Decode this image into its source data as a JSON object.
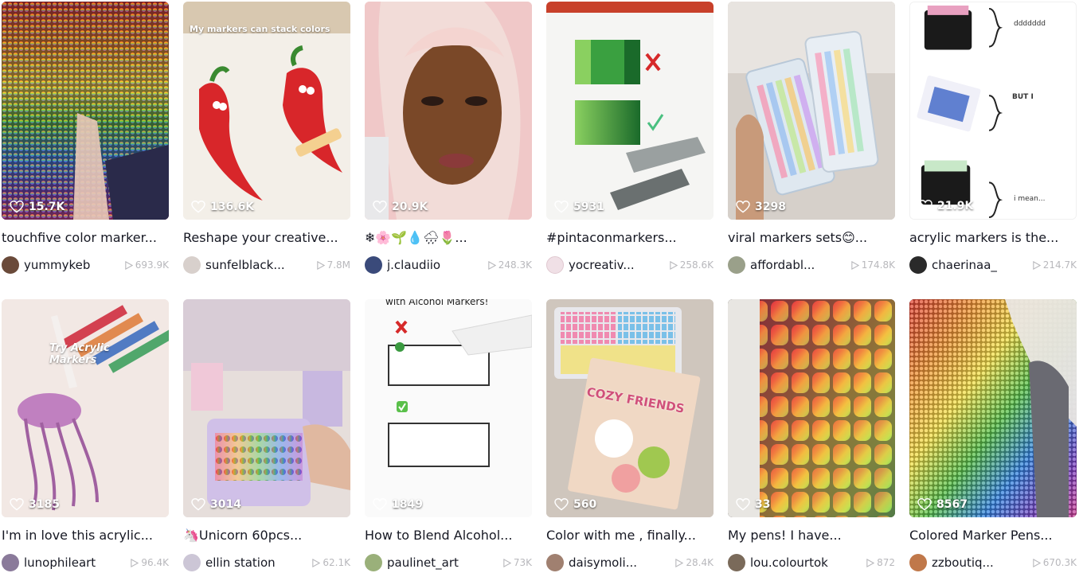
{
  "videos": [
    {
      "title": "touchfive color marker...",
      "author": "yummykeb",
      "views": "693.9K",
      "likes": "15.7K",
      "avatar_color": "#6a4a3a"
    },
    {
      "title": "Reshape your creative...",
      "author": "sunfelblack...",
      "views": "7.8M",
      "likes": "136.6K",
      "avatar_color": "#d8d0cc",
      "overlay": "My markers can stack colors"
    },
    {
      "title": "❄🌸🌱💧🌧🌷...",
      "author": "j.claudiio",
      "views": "248.3K",
      "likes": "20.9K",
      "avatar_color": "#3a4a7a"
    },
    {
      "title": "#pintaconmarkers...",
      "author": "yocreativ...",
      "views": "258.6K",
      "likes": "5931",
      "avatar_color": "#f0e0e6"
    },
    {
      "title": "viral markers sets😊...",
      "author": "affordabl...",
      "views": "174.8K",
      "likes": "3298",
      "avatar_color": "#9aa08a"
    },
    {
      "title": "acrylic markers is the...",
      "author": "chaerinaa_",
      "views": "214.7K",
      "likes": "21.9K",
      "avatar_color": "#2a2a2a",
      "notes": [
        "ddddddd",
        "BUT I",
        "i mean..."
      ]
    },
    {
      "title": "I'm in love this acrylic...",
      "author": "lunophileart",
      "views": "96.4K",
      "likes": "3185",
      "avatar_color": "#8a7a9a",
      "overlay": "Try Acrylic Markers"
    },
    {
      "title": "🦄Unicorn 60pcs...",
      "author": "ellin station",
      "views": "62.1K",
      "likes": "3014",
      "avatar_color": "#ccc6d6"
    },
    {
      "title": "How to Blend Alcohol...",
      "author": "paulinet_art",
      "views": "73K",
      "likes": "1849",
      "avatar_color": "#9ab07a",
      "overlay": "with Alcohol Markers!"
    },
    {
      "title": "Color with me , finally...",
      "author": "daisymoli...",
      "views": "28.4K",
      "likes": "560",
      "avatar_color": "#a08070",
      "overlay": "COZY FRIENDS"
    },
    {
      "title": "My pens! I have...",
      "author": "lou.colourtok",
      "views": "872",
      "likes": "33",
      "avatar_color": "#7a6a5a"
    },
    {
      "title": "Colored Marker Pens...",
      "author": "zzboutiq...",
      "views": "670.3K",
      "likes": "8567",
      "avatar_color": "#c0784a"
    }
  ]
}
